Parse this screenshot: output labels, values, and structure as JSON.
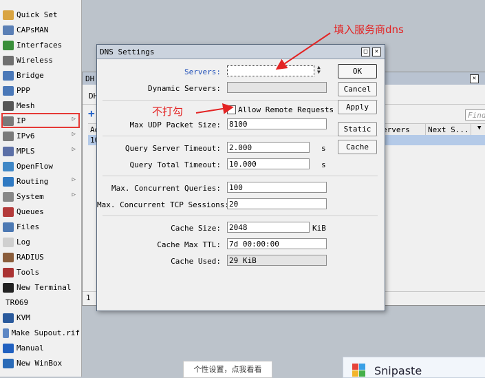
{
  "sidebar": {
    "items": [
      {
        "label": "Quick Set",
        "icon": "quick-set-icon",
        "color": "#d9a441"
      },
      {
        "label": "CAPsMAN",
        "icon": "capsman-icon",
        "color": "#5a7fb5"
      },
      {
        "label": "Interfaces",
        "icon": "interfaces-icon",
        "color": "#3a8f3a"
      },
      {
        "label": "Wireless",
        "icon": "wireless-icon",
        "color": "#6f6f6f"
      },
      {
        "label": "Bridge",
        "icon": "bridge-icon",
        "color": "#4a78b8"
      },
      {
        "label": "PPP",
        "icon": "ppp-icon",
        "color": "#4a78b8"
      },
      {
        "label": "Mesh",
        "icon": "mesh-icon",
        "color": "#555"
      },
      {
        "label": "IP",
        "icon": "ip-icon",
        "color": "#7a7a7a",
        "submenu": true
      },
      {
        "label": "IPv6",
        "icon": "ipv6-icon",
        "color": "#7a7a7a",
        "submenu": true
      },
      {
        "label": "MPLS",
        "icon": "mpls-icon",
        "color": "#5b6fa6",
        "submenu": true
      },
      {
        "label": "OpenFlow",
        "icon": "openflow-icon",
        "color": "#3f87c6"
      },
      {
        "label": "Routing",
        "icon": "routing-icon",
        "color": "#2f79c2",
        "submenu": true
      },
      {
        "label": "System",
        "icon": "system-icon",
        "color": "#888",
        "submenu": true
      },
      {
        "label": "Queues",
        "icon": "queues-icon",
        "color": "#b33a3a"
      },
      {
        "label": "Files",
        "icon": "files-icon",
        "color": "#4d79b3"
      },
      {
        "label": "Log",
        "icon": "log-icon",
        "color": "#cfcfcf"
      },
      {
        "label": "RADIUS",
        "icon": "radius-icon",
        "color": "#8a5d3b"
      },
      {
        "label": "Tools",
        "icon": "tools-icon",
        "color": "#a33"
      },
      {
        "label": "New Terminal",
        "icon": "terminal-icon",
        "color": "#222"
      },
      {
        "label": "TR069",
        "icon": "",
        "color": ""
      },
      {
        "label": "KVM",
        "icon": "kvm-icon",
        "color": "#2a5a9c"
      },
      {
        "label": "Make Supout.rif",
        "icon": "supout-icon",
        "color": "#5d87c4"
      },
      {
        "label": "Manual",
        "icon": "help-icon",
        "color": "#2060c0"
      },
      {
        "label": "New WinBox",
        "icon": "winbox-icon",
        "color": "#2a6bb8"
      }
    ]
  },
  "bg_window": {
    "title": "DH",
    "tab": "DH",
    "find_placeholder": "Find",
    "col_servers": "ervers",
    "col_next": "Next S...",
    "col_first": "Ad",
    "row_first": "10",
    "footer_count": "1"
  },
  "dns": {
    "title": "DNS Settings",
    "servers_label": "Servers:",
    "servers_value": "",
    "dynamic_servers_label": "Dynamic Servers:",
    "dynamic_servers_value": "",
    "allow_remote_label": "Allow Remote Requests",
    "allow_remote_checked": false,
    "max_udp_label": "Max UDP Packet Size:",
    "max_udp_value": "8100",
    "query_server_timeout_label": "Query Server Timeout:",
    "query_server_timeout_value": "2.000",
    "query_total_timeout_label": "Query Total Timeout:",
    "query_total_timeout_value": "10.000",
    "unit_s": "s",
    "max_concurrent_queries_label": "Max. Concurrent Queries:",
    "max_concurrent_queries_value": "100",
    "max_concurrent_tcp_label": "Max. Concurrent TCP Sessions:",
    "max_concurrent_tcp_value": "20",
    "cache_size_label": "Cache Size:",
    "cache_size_value": "2048",
    "unit_kib": "KiB",
    "cache_max_ttl_label": "Cache Max TTL:",
    "cache_max_ttl_value": "7d 00:00:00",
    "cache_used_label": "Cache Used:",
    "cache_used_value": "29 KiB",
    "buttons": {
      "ok": "OK",
      "cancel": "Cancel",
      "apply": "Apply",
      "static": "Static",
      "cache": "Cache"
    }
  },
  "annotations": {
    "fill_dns": "填入服务商dns",
    "no_check": "不打勾"
  },
  "bottom": {
    "tooltip": "个性设置，点我看看",
    "snipaste": "Snipaste"
  }
}
